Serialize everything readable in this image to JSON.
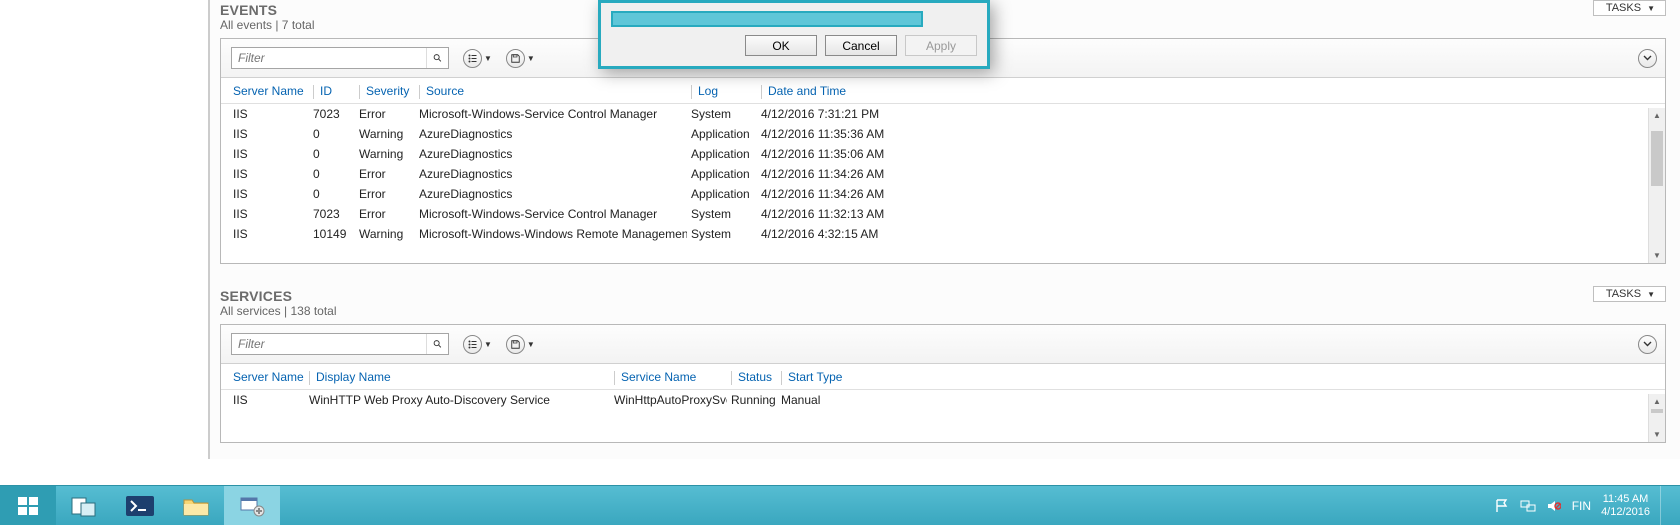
{
  "dialog": {
    "ok": "OK",
    "cancel": "Cancel",
    "apply": "Apply"
  },
  "tasks_label": "TASKS",
  "events": {
    "title": "EVENTS",
    "subtitle": "All events | 7 total",
    "filter_placeholder": "Filter",
    "cols": {
      "c0": "Server Name",
      "c1": "ID",
      "c2": "Severity",
      "c3": "Source",
      "c4": "Log",
      "c5": "Date and Time"
    },
    "rows": [
      {
        "c0": "IIS",
        "c1": "7023",
        "c2": "Error",
        "c3": "Microsoft-Windows-Service Control Manager",
        "c4": "System",
        "c5": "4/12/2016 7:31:21 PM"
      },
      {
        "c0": "IIS",
        "c1": "0",
        "c2": "Warning",
        "c3": "AzureDiagnostics",
        "c4": "Application",
        "c5": "4/12/2016 11:35:36 AM"
      },
      {
        "c0": "IIS",
        "c1": "0",
        "c2": "Warning",
        "c3": "AzureDiagnostics",
        "c4": "Application",
        "c5": "4/12/2016 11:35:06 AM"
      },
      {
        "c0": "IIS",
        "c1": "0",
        "c2": "Error",
        "c3": "AzureDiagnostics",
        "c4": "Application",
        "c5": "4/12/2016 11:34:26 AM"
      },
      {
        "c0": "IIS",
        "c1": "0",
        "c2": "Error",
        "c3": "AzureDiagnostics",
        "c4": "Application",
        "c5": "4/12/2016 11:34:26 AM"
      },
      {
        "c0": "IIS",
        "c1": "7023",
        "c2": "Error",
        "c3": "Microsoft-Windows-Service Control Manager",
        "c4": "System",
        "c5": "4/12/2016 11:32:13 AM"
      },
      {
        "c0": "IIS",
        "c1": "10149",
        "c2": "Warning",
        "c3": "Microsoft-Windows-Windows Remote Management",
        "c4": "System",
        "c5": "4/12/2016 4:32:15 AM"
      }
    ]
  },
  "services": {
    "title": "SERVICES",
    "subtitle": "All services | 138 total",
    "filter_placeholder": "Filter",
    "cols": {
      "c0": "Server Name",
      "c1": "Display Name",
      "c2": "Service Name",
      "c3": "Status",
      "c4": "Start Type"
    },
    "rows": [
      {
        "c0": "IIS",
        "c1": "WinHTTP Web Proxy Auto-Discovery Service",
        "c2": "WinHttpAutoProxySvc",
        "c3": "Running",
        "c4": "Manual"
      }
    ]
  },
  "tray": {
    "lang": "FIN",
    "time": "11:45 AM",
    "date": "4/12/2016"
  }
}
